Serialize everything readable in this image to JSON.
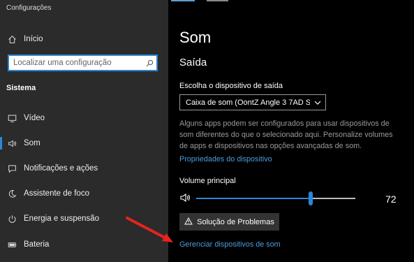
{
  "app": {
    "title": "Configurações"
  },
  "sidebar": {
    "home_label": "Início",
    "search_placeholder": "Localizar uma configuração",
    "section": "Sistema",
    "items": [
      {
        "label": "Vídeo",
        "icon": "monitor-icon"
      },
      {
        "label": "Som",
        "icon": "speaker-icon",
        "active": true
      },
      {
        "label": "Notificações e ações",
        "icon": "notification-icon"
      },
      {
        "label": "Assistente de foco",
        "icon": "moon-icon"
      },
      {
        "label": "Energia e suspensão",
        "icon": "power-icon"
      },
      {
        "label": "Bateria",
        "icon": "battery-icon"
      }
    ]
  },
  "main": {
    "title": "Som",
    "subtitle": "Saída",
    "output_device_label": "Escolha o dispositivo de saída",
    "output_device_value": "Caixa de som (OontZ Angle 3 7AD S...",
    "description": "Alguns apps podem ser configurados para usar dispositivos de som diferentes do que o selecionado aqui. Personalize volumes de apps e dispositivos nas opções avançadas de som.",
    "device_properties_link": "Propriedades do dispositivo",
    "volume_label": "Volume principal",
    "volume_value": "72",
    "volume_fraction": 0.72,
    "troubleshoot_button": "Solução de Problemas",
    "manage_devices_link": "Gerenciar dispositivos de som"
  },
  "colors": {
    "accent": "#2b88d8",
    "link": "#4a9ee0",
    "sidebar_bg": "#2b2b2b",
    "annotation_arrow": "#e8231c"
  }
}
